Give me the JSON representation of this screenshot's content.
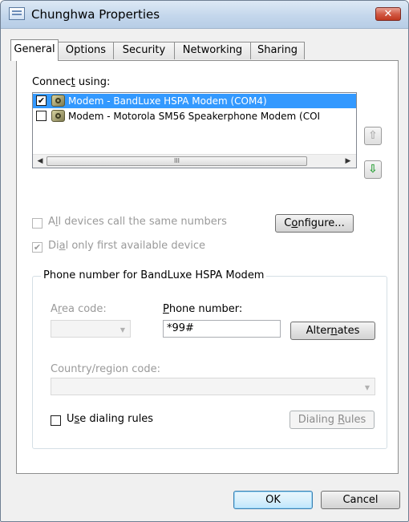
{
  "window": {
    "title": "Chunghwa Properties"
  },
  "tabs": [
    {
      "label": "General",
      "active": true
    },
    {
      "label": "Options",
      "active": false
    },
    {
      "label": "Security",
      "active": false
    },
    {
      "label": "Networking",
      "active": false
    },
    {
      "label": "Sharing",
      "active": false
    }
  ],
  "connect_using": {
    "label_pre": "Connec",
    "label_key": "t",
    "label_post": " using:",
    "devices": [
      {
        "checked": true,
        "selected": true,
        "icon": "modem-icon",
        "name": "Modem - BandLuxe HSPA Modem (COM4)"
      },
      {
        "checked": false,
        "selected": false,
        "icon": "modem-icon",
        "name": "Modem - Motorola SM56 Speakerphone Modem (COI"
      }
    ],
    "scroll_thumb_glyph": "III",
    "move_up_glyph": "⇧",
    "move_down_glyph": "⇩"
  },
  "options": {
    "all_devices_pre": "A",
    "all_devices_key": "l",
    "all_devices_post": "l devices call the same numbers",
    "all_devices_checked": false,
    "configure_pre": "C",
    "configure_key": "o",
    "configure_post": "nfigure...",
    "dial_first_pre": "Di",
    "dial_first_key": "a",
    "dial_first_post": "l only first available device",
    "dial_first_checked": true
  },
  "phone_group": {
    "title": "Phone number for BandLuxe HSPA Modem",
    "area_code_pre": "A",
    "area_code_key": "r",
    "area_code_post": "ea code:",
    "area_code_value": "",
    "phone_number_pre": "",
    "phone_number_key": "P",
    "phone_number_post": "hone number:",
    "phone_number_value": "*99#",
    "alternates_pre": "Alter",
    "alternates_key": "n",
    "alternates_post": "ates",
    "country_label": "Country/region code:",
    "country_value": "",
    "use_rules_pre": "U",
    "use_rules_key": "s",
    "use_rules_post": "e dialing rules",
    "use_rules_checked": false,
    "dialing_rules_pre": "Dialing ",
    "dialing_rules_key": "R",
    "dialing_rules_post": "ules"
  },
  "footer": {
    "ok_label": "OK",
    "cancel_label": "Cancel"
  },
  "colors": {
    "selection": "#3399ff",
    "close_button": "#d25a45",
    "move_down_arrow": "#2da13a",
    "move_up_arrow": "#b0b0b0"
  }
}
